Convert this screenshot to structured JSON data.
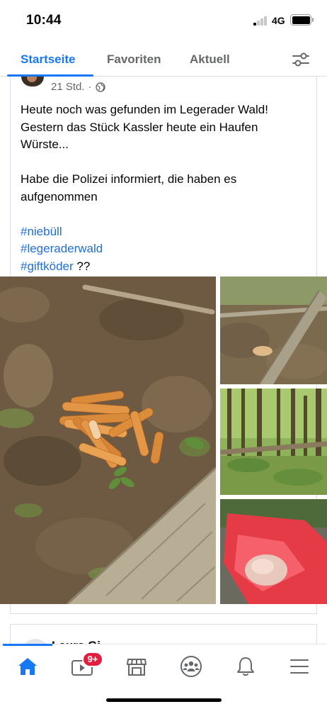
{
  "status_bar": {
    "time": "10:44",
    "network": "4G"
  },
  "tabs": [
    {
      "label": "Startseite",
      "active": true
    },
    {
      "label": "Favoriten",
      "active": false
    },
    {
      "label": "Aktuell",
      "active": false
    }
  ],
  "post": {
    "time_ago": "21 Std.",
    "separator": "·",
    "text_lines": [
      "Heute noch was gefunden im Legerader Wald!",
      "Gestern das Stück Kassler heute ein Haufen",
      "Würste..."
    ],
    "text_lines_2": [
      "Habe die Polizei informiert, die haben es",
      "aufgenommen"
    ],
    "hashtags": [
      "#niebüll",
      "#legeraderwald",
      "#giftköder"
    ],
    "hashtag_suffix": " ??"
  },
  "next_post": {
    "author": "Laura Gi"
  },
  "bottom_nav": {
    "badge": "9+",
    "items": [
      "home-icon",
      "video-icon",
      "marketplace-icon",
      "groups-icon",
      "notifications-icon",
      "menu-icon"
    ]
  },
  "colors": {
    "accent": "#1877f2",
    "hashtag": "#216fdb",
    "badge": "#e41e3f",
    "muted": "#65676b"
  }
}
